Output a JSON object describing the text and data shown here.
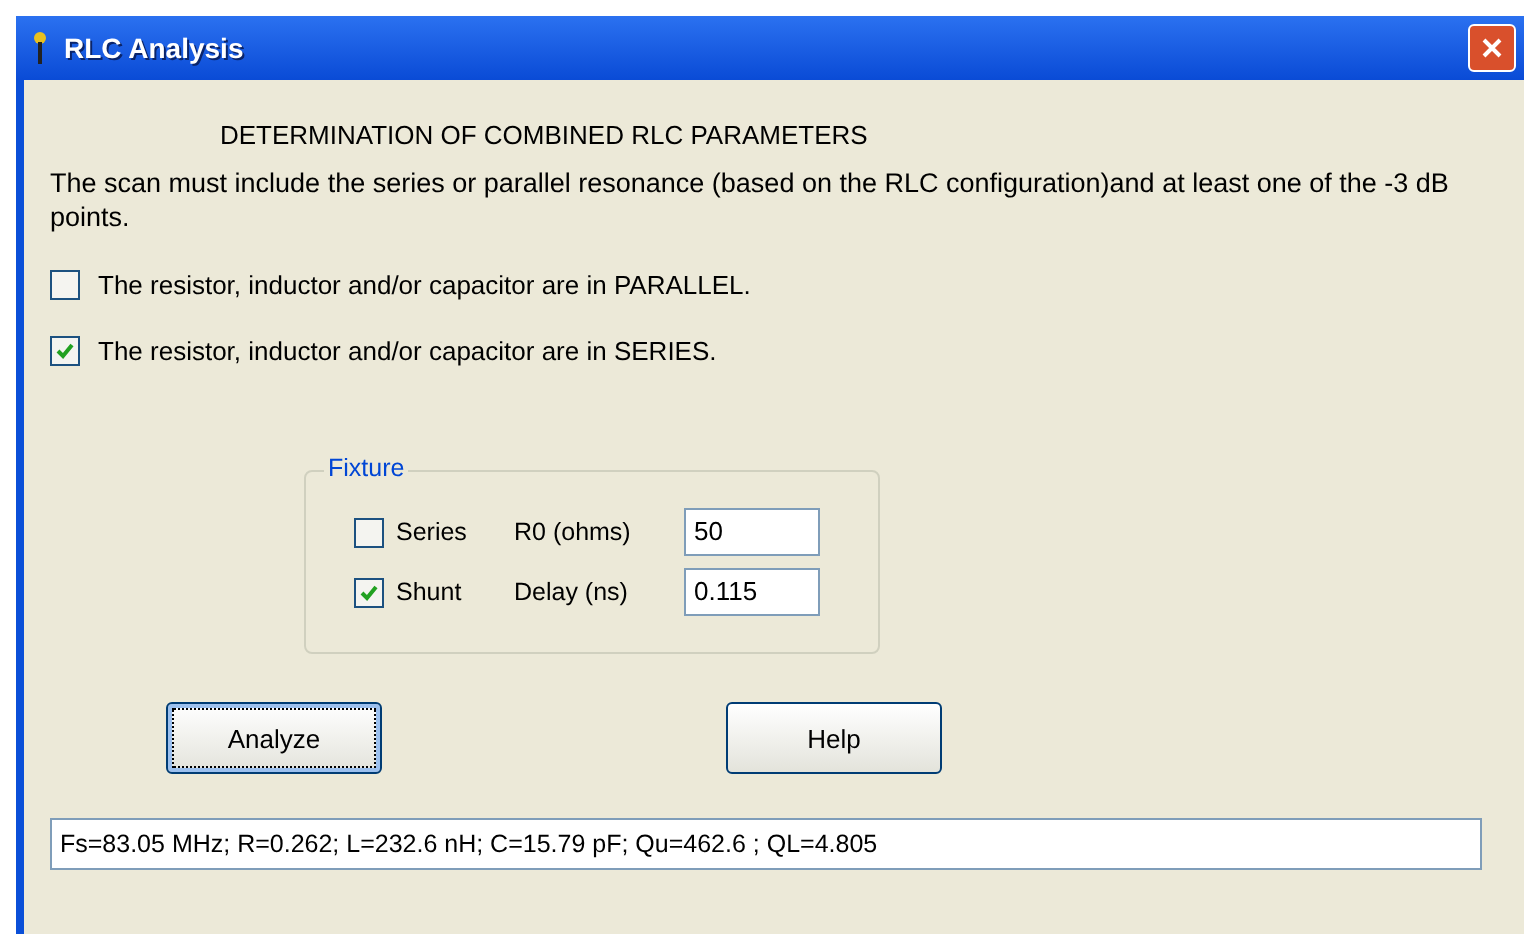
{
  "window": {
    "title": "RLC Analysis"
  },
  "heading": "DETERMINATION OF COMBINED RLC PARAMETERS",
  "description": "The scan must include the series or parallel resonance (based on the RLC configuration)and at least one of the -3 dB points.",
  "config_options": [
    {
      "label": "The resistor, inductor and/or capacitor are in PARALLEL.",
      "checked": false
    },
    {
      "label": "The resistor, inductor and/or capacitor are in SERIES.",
      "checked": true
    }
  ],
  "fixture": {
    "title": "Fixture",
    "options": [
      {
        "label": "Series",
        "checked": false
      },
      {
        "label": "Shunt",
        "checked": true
      }
    ],
    "fields": [
      {
        "label": "R0 (ohms)",
        "value": "50"
      },
      {
        "label": "Delay (ns)",
        "value": "0.115"
      }
    ]
  },
  "buttons": [
    {
      "label": "Analyze",
      "focused": true
    },
    {
      "label": "Help",
      "focused": false
    }
  ],
  "result": {
    "value": "Fs=83.05 MHz; R=0.262; L=232.6 nH; C=15.79 pF; Qu=462.6 ; QL=4.805"
  }
}
